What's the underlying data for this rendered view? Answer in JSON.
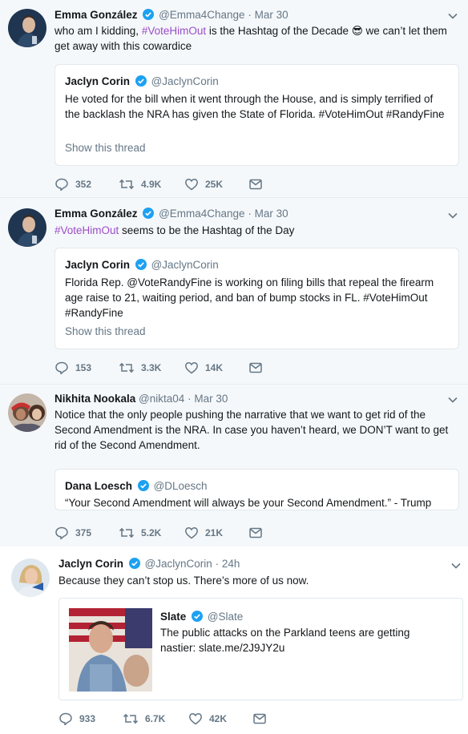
{
  "tweets": [
    {
      "name": "Emma González",
      "handle": "@Emma4Change",
      "sep": "·",
      "time": "Mar 30",
      "text_before": "who am I kidding, ",
      "hashtag": "#VoteHimOut",
      "text_after": " is the Hashtag of the Decade 😎 we can’t let them get away with this cowardice",
      "quote": {
        "name": "Jaclyn Corin",
        "handle": "@JaclynCorin",
        "text": "He voted for the bill when it went through the House, and is simply terrified of the backlash the NRA has given the State of Florida. #VoteHimOut #RandyFine",
        "show_thread": "Show this thread"
      },
      "replies": "352",
      "retweets": "4.9K",
      "likes": "25K"
    },
    {
      "name": "Emma González",
      "handle": "@Emma4Change",
      "sep": "·",
      "time": "Mar 30",
      "hashtag": "#VoteHimOut",
      "text_after": " seems to be the Hashtag of the Day",
      "quote": {
        "name": "Jaclyn Corin",
        "handle": "@JaclynCorin",
        "text": "Florida Rep. @VoteRandyFine is working on filing bills that repeal the firearm age raise to 21, waiting period, and ban of bump stocks in FL. #VoteHimOut #RandyFine",
        "show_thread": "Show this thread"
      },
      "replies": "153",
      "retweets": "3.3K",
      "likes": "14K"
    },
    {
      "name": "Nikhita Nookala",
      "handle": "@nikta04",
      "sep": "·",
      "time": "Mar 30",
      "text": "Notice that the only people pushing the narrative that we want to get rid of the Second Amendment is the NRA. In case you haven’t heard, we DON’T want to get rid of the Second Amendment.",
      "quote": {
        "name": "Dana Loesch",
        "handle": "@DLoesch",
        "text": "“Your Second Amendment will always be your Second Amendment.” - Trump"
      },
      "replies": "375",
      "retweets": "5.2K",
      "likes": "21K"
    },
    {
      "name": "Jaclyn Corin",
      "handle": "@JaclynCorin",
      "sep": "·",
      "time": "24h",
      "text": "Because they can’t stop us. There’s more of us now.",
      "card": {
        "name": "Slate",
        "handle": "@Slate",
        "text": "The public attacks on the Parkland teens are getting nastier: slate.me/2J9JY2u"
      },
      "replies": "933",
      "retweets": "6.7K",
      "likes": "42K"
    }
  ],
  "colors": {
    "hashtag": "#9b4cc9",
    "verified": "#1da1f2",
    "muted": "#657786",
    "highlight_bg": "#f5f8fa"
  },
  "icons": [
    "reply-icon",
    "retweet-icon",
    "like-icon",
    "dm-icon",
    "verified-badge-icon",
    "chevron-down-icon"
  ]
}
